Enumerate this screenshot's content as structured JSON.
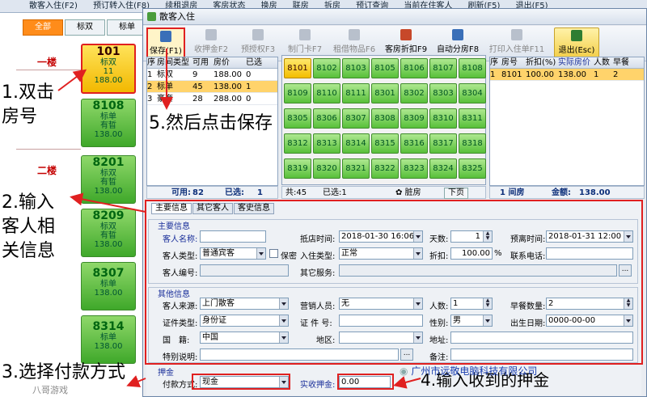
{
  "bg": {
    "menu": [
      "散客入住(F2)",
      "预订转入住(F8)",
      "续租退房",
      "客房状态",
      "换房",
      "联房",
      "拆房",
      "预订查询",
      "当前在住客人",
      "刷新(F5)",
      "退出(F5)"
    ],
    "tabs": [
      "全部",
      "标双",
      "标单"
    ],
    "floors": [
      "一楼",
      "二楼"
    ],
    "room_cards": [
      {
        "no": "101",
        "lines": [
          "标双",
          "11",
          "188.00"
        ],
        "selected": true
      },
      {
        "no": "8108",
        "lines": [
          "标单",
          "有晢",
          "138.00"
        ]
      },
      {
        "no": "8201",
        "lines": [
          "标双",
          "有晢",
          "138.00"
        ]
      },
      {
        "no": "8209",
        "lines": [
          "标双",
          "有晢",
          "138.00"
        ]
      },
      {
        "no": "8307",
        "lines": [
          "标单",
          "138.00"
        ]
      },
      {
        "no": "8314",
        "lines": [
          "标单",
          "138.00"
        ]
      }
    ]
  },
  "dialog": {
    "title": "散客入住",
    "toolbar": [
      {
        "label": "保存(F1)",
        "active": true
      },
      {
        "label": "收押金F2"
      },
      {
        "label": "预授权F3"
      },
      {
        "label": "制门卡F7"
      },
      {
        "label": "租借物品F6"
      },
      {
        "label": "客房折扣F9",
        "active": true
      },
      {
        "label": "自动分房F8",
        "active": true
      },
      {
        "label": "打印入住单F11"
      },
      {
        "label": "退出(Esc)",
        "active": true
      }
    ],
    "type_table": {
      "headers": [
        "序",
        "房间类型",
        "可用",
        "房价",
        "已选"
      ],
      "rows": [
        [
          "1",
          "标双",
          "9",
          "188.00",
          "0"
        ],
        [
          "2",
          "标单",
          "45",
          "138.00",
          "1"
        ],
        [
          "3",
          "豪套",
          "28",
          "288.00",
          "0"
        ]
      ],
      "selected_row": 1,
      "footer_available_label": "可用:",
      "footer_available": "82",
      "footer_selected_label": "已选:",
      "footer_selected": "1"
    },
    "room_grid": {
      "rooms": [
        "8101",
        "8102",
        "8103",
        "8105",
        "8106",
        "8107",
        "8108",
        "8109",
        "8110",
        "8111",
        "8301",
        "8302",
        "8303",
        "8304",
        "8305",
        "8306",
        "8307",
        "8308",
        "8309",
        "8310",
        "8311",
        "8312",
        "8313",
        "8314",
        "8315",
        "8316",
        "8317",
        "8318",
        "8319",
        "8320",
        "8321",
        "8322",
        "8323",
        "8324",
        "8325"
      ],
      "selected": "8101",
      "footer_total": "共:45",
      "footer_selected": "已选:1",
      "footer_dirty": "脏房",
      "footer_next": "下页"
    },
    "selected_table": {
      "headers": [
        "序",
        "房号",
        "折扣(%)",
        "实际房价",
        "人数",
        "早餐"
      ],
      "rows": [
        [
          "1",
          "8101",
          "100.00",
          "138.00",
          "1",
          "2"
        ]
      ],
      "footer_rooms": "1  间房",
      "footer_amount_label": "金额:",
      "footer_amount": "138.00"
    },
    "form_tabs": [
      "主要信息",
      "其它客人",
      "客史信息"
    ],
    "main_info": {
      "group_title": "主要信息",
      "guest_name_label": "客人名称:",
      "guest_name": "",
      "checkin_time_label": "抵店时间:",
      "checkin_time": "2018-01-30 16:06",
      "days_label": "天数:",
      "days": "1",
      "checkout_label": "预离时间:",
      "checkout_time": "2018-01-31 12:00",
      "guest_type_label": "客人类型:",
      "guest_type": "普通宾客",
      "secret_label": "保密",
      "stay_type_label": "入住类型:",
      "stay_type": "正常",
      "discount_label": "折扣:",
      "discount": "100.00",
      "discount_unit": "%",
      "phone_label": "联系电话:",
      "guest_no_label": "客人编号:",
      "other_service_label": "其它服务:"
    },
    "other_info": {
      "group_title": "其他信息",
      "source_label": "客人来源:",
      "source": "上门散客",
      "sales_label": "营销人员:",
      "sales": "无",
      "people_label": "人数:",
      "people": "1",
      "breakfast_label": "早餐数量:",
      "breakfast": "2",
      "id_type_label": "证件类型:",
      "id_type": "身份证",
      "id_no_label": "证 件 号:",
      "gender_label": "性别:",
      "gender": "男",
      "birth_label": "出生日期:",
      "birth": "0000-00-00",
      "nation_label": "国　籍:",
      "nation": "中国",
      "area_label": "地区:",
      "address_label": "地址:",
      "note_label": "特别说明:",
      "remark_label": "备注:"
    },
    "deposit": {
      "group_title": "押金",
      "pay_label": "付款方式:",
      "pay_method": "现金",
      "amount_label": "实收押金:",
      "amount": "0.00"
    }
  },
  "annotations": {
    "step1": "1.双击\n房号",
    "step2": "2.输入\n客人相\n关信息",
    "step3": "3.选择付款方式",
    "step4": "4.输入收到的押金",
    "step5": "5.然后点击保存",
    "watermark": "广州市远敬电脑科技有限公司",
    "corner_text": "八哥游戏"
  }
}
